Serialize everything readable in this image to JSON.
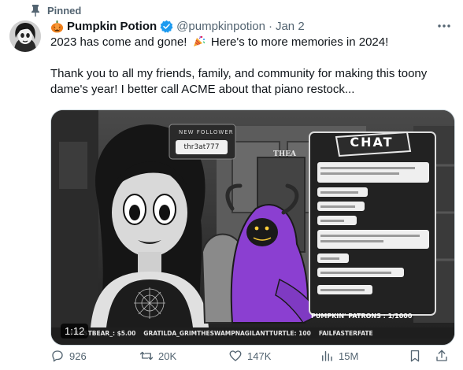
{
  "pinned": {
    "label": "Pinned"
  },
  "author": {
    "display_name": "Pumpkin Potion",
    "handle": "@pumpkinpotion",
    "separator": "·",
    "date": "Jan 2"
  },
  "tweet": {
    "line1_a": "2023 has come and gone!",
    "line1_b": "Here's to more memories in 2024!",
    "line2": "Thank you to all my friends, family, and community for making this toony dame's year!  I better call ACME about that piano restock..."
  },
  "media": {
    "duration": "1:12",
    "overlay": {
      "new_follower_label": "NEW FOLLOWER",
      "follower_name": "thr3at777",
      "chat_title": "CHAT",
      "patrons": "PUMPKIN' PATRONS :   1/1000",
      "ticker": [
        "FROSTBEAR_: $5.00",
        "GRATILDA_GRIMTHESWAMPNAGILANTTURTLE: 100",
        "FAILFASTERFATE"
      ]
    }
  },
  "stats": {
    "replies": "926",
    "retweets": "20K",
    "likes": "147K",
    "views": "15M"
  },
  "colors": {
    "text_primary": "#0f1419",
    "text_secondary": "#536471",
    "verified": "#1d9bf0",
    "hood_purple": "#8b3fd1"
  },
  "icons": {
    "pin": "pin-icon",
    "verified": "verified-badge-icon",
    "party": "party-popper-icon",
    "reply": "reply-icon",
    "retweet": "retweet-icon",
    "like": "heart-icon",
    "views": "views-icon",
    "bookmark": "bookmark-icon",
    "share": "share-icon"
  }
}
